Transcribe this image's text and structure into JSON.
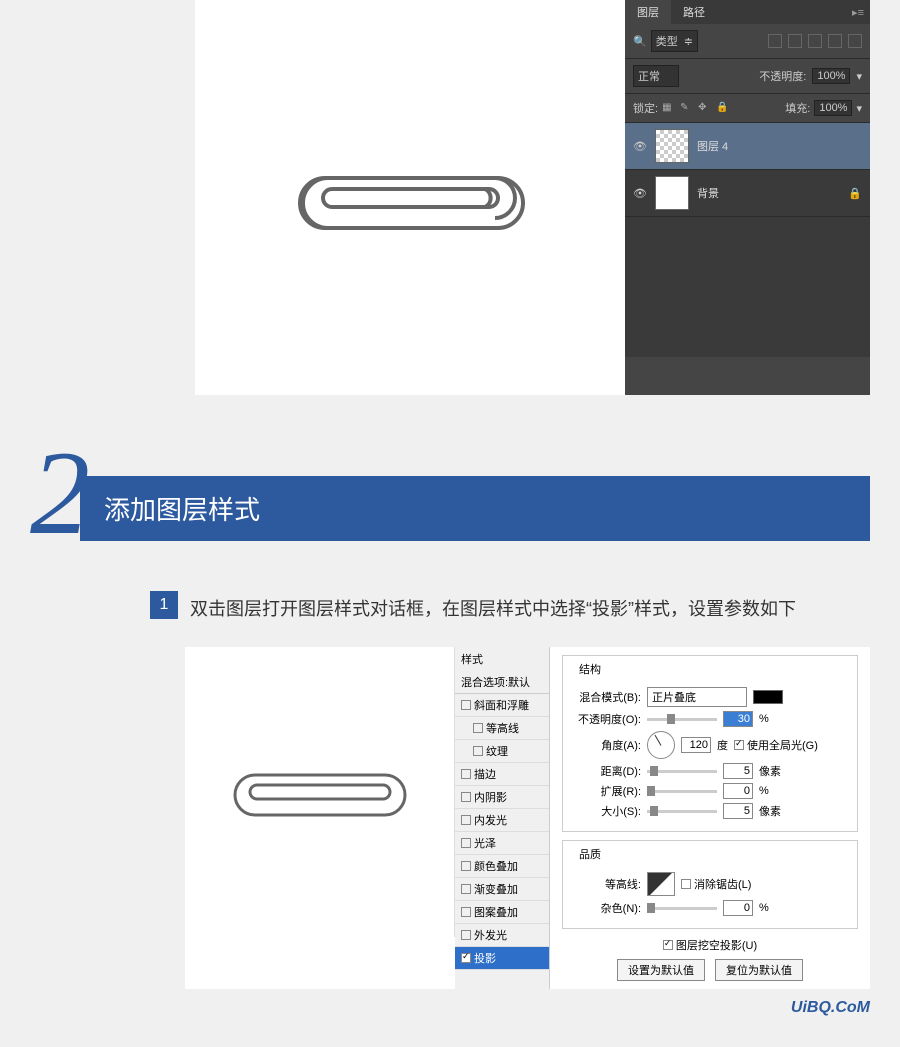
{
  "layers_panel": {
    "tabs": {
      "layers": "图层",
      "paths": "路径"
    },
    "filter_label": "类型",
    "blend_mode": "正常",
    "opacity_label": "不透明度:",
    "opacity_value": "100%",
    "lock_label": "锁定:",
    "fill_label": "填充:",
    "fill_value": "100%",
    "layer1_name": "图层 4",
    "layer2_name": "背景"
  },
  "step": {
    "number": "2",
    "title": "添加图层样式"
  },
  "substep": {
    "number": "1",
    "text": "双击图层打开图层样式对话框，在图层样式中选择“投影”样式，设置参数如下"
  },
  "style_list": {
    "header": "样式",
    "subheader": "混合选项:默认",
    "items": {
      "bevel": "斜面和浮雕",
      "contour_sub": "等高线",
      "texture": "纹理",
      "stroke": "描边",
      "inner_shadow": "内阴影",
      "inner_glow": "内发光",
      "satin": "光泽",
      "color_overlay": "颜色叠加",
      "gradient_overlay": "渐变叠加",
      "pattern_overlay": "图案叠加",
      "outer_glow": "外发光",
      "drop_shadow": "投影"
    }
  },
  "settings": {
    "structure_title": "结构",
    "blend_mode_label": "混合模式(B):",
    "blend_mode_value": "正片叠底",
    "opacity_label": "不透明度(O):",
    "opacity_value": "30",
    "opacity_unit": "%",
    "angle_label": "角度(A):",
    "angle_value": "120",
    "angle_unit": "度",
    "global_light": "使用全局光(G)",
    "distance_label": "距离(D):",
    "distance_value": "5",
    "distance_unit": "像素",
    "spread_label": "扩展(R):",
    "spread_value": "0",
    "spread_unit": "%",
    "size_label": "大小(S):",
    "size_value": "5",
    "size_unit": "像素",
    "quality_title": "品质",
    "contour_label": "等高线:",
    "antialias": "消除锯齿(L)",
    "noise_label": "杂色(N):",
    "noise_value": "0",
    "noise_unit": "%",
    "knockout": "图层挖空投影(U)",
    "set_default": "设置为默认值",
    "reset_default": "复位为默认值"
  },
  "watermark": "UiBQ.CoM"
}
